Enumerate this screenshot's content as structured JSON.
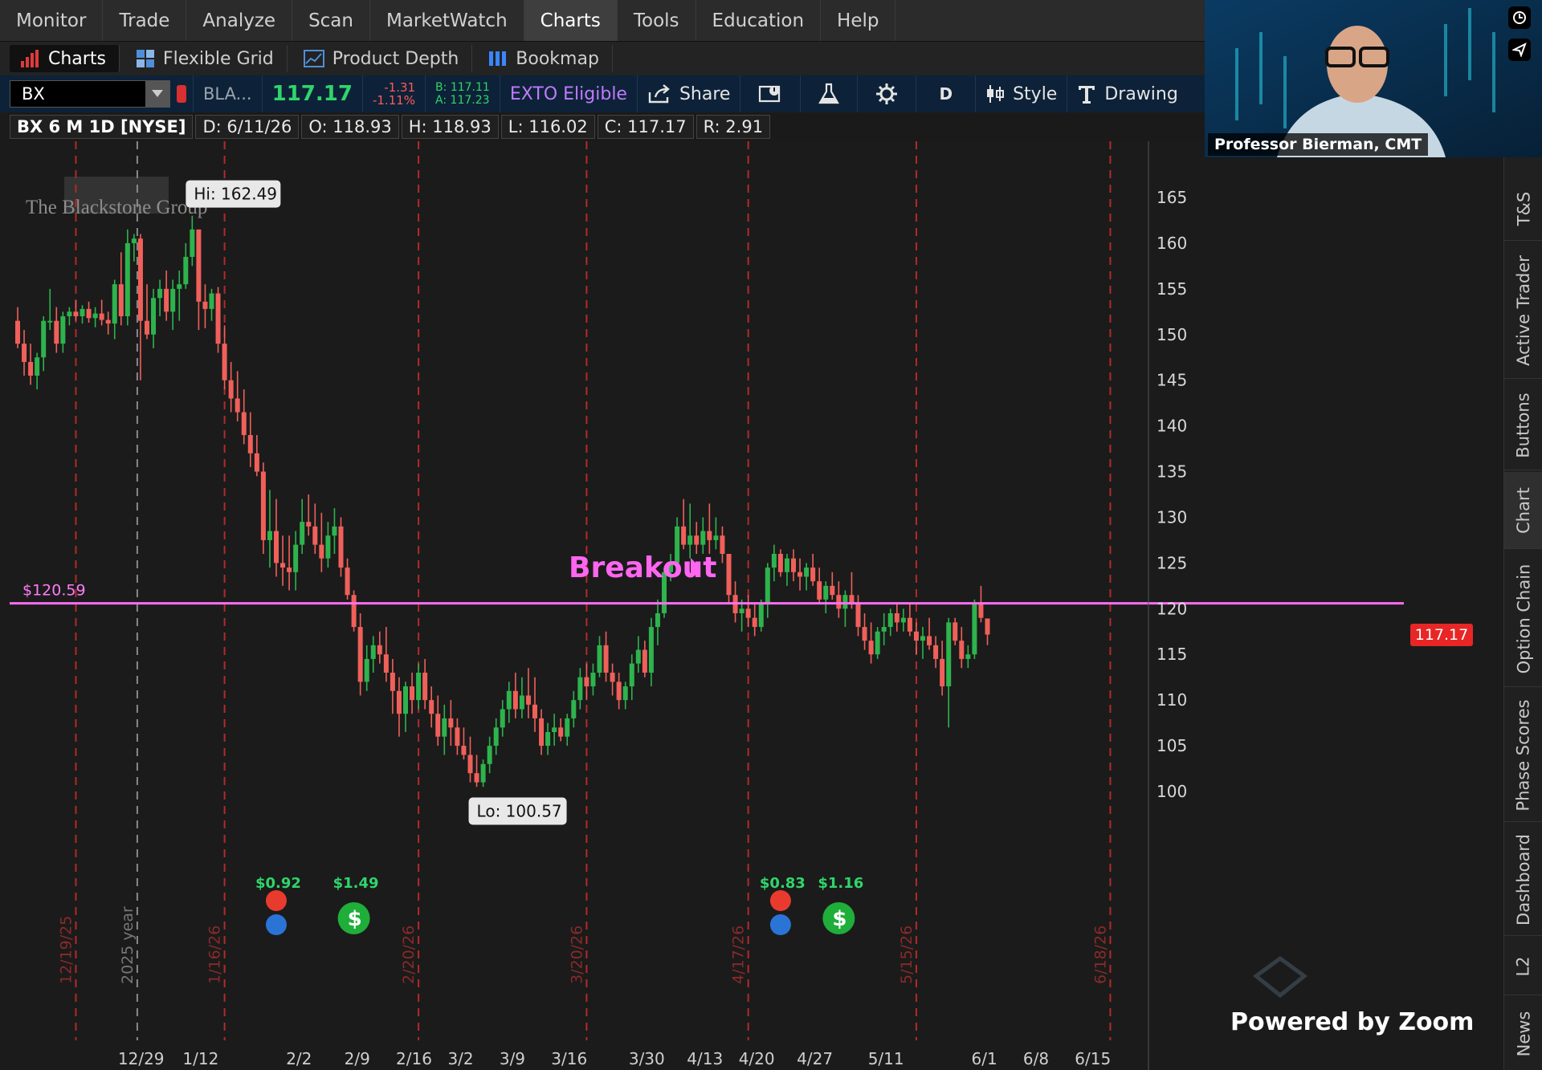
{
  "menu": [
    "Monitor",
    "Trade",
    "Analyze",
    "Scan",
    "MarketWatch",
    "Charts",
    "Tools",
    "Education",
    "Help"
  ],
  "subtabs": {
    "charts": "Charts",
    "flexible_grid": "Flexible Grid",
    "product_depth": "Product Depth",
    "bookmap": "Bookmap"
  },
  "toolbar": {
    "symbol": "BX",
    "company": "BLA...",
    "last": "117.17",
    "change": "-1.31",
    "change_pct": "-1.11%",
    "bid": "B: 117.11",
    "ask": "A: 117.23",
    "exto": "EXTO Eligible",
    "share": "Share",
    "aggregation": "D",
    "style": "Style",
    "drawings": "Drawing"
  },
  "infobar": {
    "title": "BX 6 M 1D [NYSE]",
    "date": "D: 6/11/26",
    "open": "O: 118.93",
    "high": "H: 118.93",
    "low": "L: 116.02",
    "close": "C: 117.17",
    "range": "R: 2.91"
  },
  "chart_data": {
    "type": "candlestick",
    "symbol": "BX",
    "watermark": "The Blackstone Group",
    "ylim": [
      98,
      169
    ],
    "yticks": [
      100,
      105,
      110,
      115,
      120,
      125,
      130,
      135,
      140,
      145,
      150,
      155,
      160,
      165
    ],
    "xticks": [
      "12/29",
      "1/12",
      "2/2",
      "2/9",
      "2/16",
      "3/2",
      "3/9",
      "3/16",
      "3/30",
      "4/13",
      "4/20",
      "4/27",
      "5/11",
      "6/1",
      "6/8",
      "6/15"
    ],
    "session_markers": [
      "12/19/25",
      "1/16/26",
      "2/20/26",
      "3/20/26",
      "4/17/26",
      "5/15/26",
      "6/18/26"
    ],
    "year_marker": "2025 year",
    "high_label": "Hi: 162.49",
    "low_label": "Lo: 100.57",
    "horizontal_line": {
      "value": 120.59,
      "label": "$120.59",
      "color": "#ff6ef5"
    },
    "annotation": "Breakout",
    "last_price_tag": "117.17",
    "dividends": [
      "$0.92",
      "$1.49",
      "$0.83",
      "$1.16"
    ],
    "colors": {
      "up": "#2eb34d",
      "down": "#f0605a",
      "background": "#1b1b1b",
      "expiration": "#b32a2a"
    },
    "candles": [
      [
        151.5,
        153,
        148.5,
        149
      ],
      [
        149,
        150.5,
        145.5,
        147
      ],
      [
        147,
        149,
        144.5,
        145.5
      ],
      [
        145.5,
        148,
        144,
        147.5
      ],
      [
        147.5,
        152,
        146,
        151.5
      ],
      [
        151.5,
        155,
        150.5,
        151.5
      ],
      [
        151.5,
        153,
        148,
        149
      ],
      [
        149,
        152.5,
        148,
        152
      ],
      [
        152,
        153,
        151,
        152.5
      ],
      [
        152.5,
        153.8,
        151.5,
        152
      ],
      [
        152,
        153.2,
        151.2,
        152.8
      ],
      [
        152.8,
        153.6,
        151.3,
        151.8
      ],
      [
        151.8,
        153,
        150.8,
        152.3
      ],
      [
        152.3,
        153.8,
        151,
        151.6
      ],
      [
        151.6,
        152.5,
        150,
        151.2
      ],
      [
        151.2,
        156,
        149.5,
        155.5
      ],
      [
        155.5,
        159,
        151,
        152
      ],
      [
        152,
        161.5,
        151,
        160
      ],
      [
        160,
        161,
        158,
        160.5
      ],
      [
        160.5,
        161,
        145,
        151.5
      ],
      [
        151.5,
        155.5,
        149.5,
        150
      ],
      [
        150,
        155,
        148.5,
        154
      ],
      [
        154,
        156,
        152,
        155
      ],
      [
        155,
        157,
        151.5,
        152.5
      ],
      [
        152.5,
        156,
        150.5,
        155
      ],
      [
        155,
        157,
        151.5,
        155.5
      ],
      [
        155.5,
        160,
        155,
        158.5
      ],
      [
        158.5,
        163,
        157.5,
        161.5
      ],
      [
        161.5,
        160.6,
        150.5,
        153.6
      ],
      [
        153.6,
        155.5,
        150.7,
        152.8
      ],
      [
        152.8,
        155,
        151.5,
        154.5
      ],
      [
        154.5,
        155.2,
        148,
        149
      ],
      [
        149,
        151,
        144,
        145
      ],
      [
        145,
        147,
        141.5,
        143
      ],
      [
        143,
        146,
        140.5,
        141.5
      ],
      [
        141.5,
        144,
        138,
        139
      ],
      [
        139,
        141.5,
        135.5,
        137
      ],
      [
        137,
        139,
        134.5,
        135
      ],
      [
        135,
        136,
        126,
        127.5
      ],
      [
        127.5,
        133,
        124.5,
        128.5
      ],
      [
        128.5,
        132,
        123.5,
        125
      ],
      [
        125,
        128,
        122.5,
        124.5
      ],
      [
        124.5,
        128,
        122,
        124
      ],
      [
        124,
        128.5,
        122,
        127
      ],
      [
        127,
        132,
        126,
        129.5
      ],
      [
        129.5,
        132.5,
        128,
        129
      ],
      [
        129,
        131.5,
        126,
        127
      ],
      [
        127,
        130.5,
        124,
        125.5
      ],
      [
        125.5,
        129.5,
        124.5,
        128
      ],
      [
        128,
        131,
        126,
        129
      ],
      [
        129,
        130,
        123.5,
        124.5
      ],
      [
        124.5,
        125.5,
        121,
        121.5
      ],
      [
        121.5,
        122,
        117.5,
        118
      ],
      [
        118,
        119.5,
        110.5,
        112
      ],
      [
        112,
        116,
        111,
        114.5
      ],
      [
        114.5,
        117,
        113,
        116
      ],
      [
        116,
        117.5,
        114,
        115
      ],
      [
        115,
        118,
        112,
        113
      ],
      [
        113,
        114.5,
        108.5,
        111
      ],
      [
        111,
        112.5,
        106,
        108.5
      ],
      [
        108.5,
        112,
        106.5,
        111.5
      ],
      [
        111.5,
        113,
        108.5,
        110
      ],
      [
        110,
        114,
        109,
        113
      ],
      [
        113,
        114.5,
        109,
        110
      ],
      [
        110,
        111.5,
        107,
        108.5
      ],
      [
        108.5,
        110.5,
        105,
        106
      ],
      [
        106,
        109.5,
        104,
        108
      ],
      [
        108,
        110,
        105,
        107
      ],
      [
        107,
        108,
        104,
        105
      ],
      [
        105,
        107,
        103.5,
        104
      ],
      [
        104,
        106,
        101,
        102
      ],
      [
        102,
        104,
        100.5,
        101
      ],
      [
        101,
        103.5,
        100.5,
        103
      ],
      [
        103,
        106,
        102,
        105
      ],
      [
        105,
        108,
        104,
        107
      ],
      [
        107,
        110,
        106,
        109
      ],
      [
        109,
        112,
        107.5,
        111
      ],
      [
        111,
        113,
        108,
        109
      ],
      [
        109,
        112.5,
        108,
        110.5
      ],
      [
        110.5,
        113.5,
        108,
        109.5
      ],
      [
        109.5,
        112.5,
        106.5,
        108
      ],
      [
        108,
        109,
        104,
        105
      ],
      [
        105,
        107.5,
        104,
        106.5
      ],
      [
        106.5,
        108.5,
        105,
        107
      ],
      [
        107,
        108,
        105.5,
        106
      ],
      [
        106,
        108.5,
        105,
        108
      ],
      [
        108,
        111,
        107,
        110
      ],
      [
        110,
        113.5,
        109,
        112.5
      ],
      [
        112.5,
        114,
        110,
        111.5
      ],
      [
        111.5,
        114,
        110.5,
        113
      ],
      [
        113,
        117,
        112.5,
        116
      ],
      [
        116,
        117.5,
        112,
        113
      ],
      [
        113,
        114,
        110.5,
        112
      ],
      [
        112,
        113,
        109,
        110
      ],
      [
        110,
        112,
        109,
        111.5
      ],
      [
        111.5,
        115,
        110,
        114
      ],
      [
        114,
        117,
        113,
        115.5
      ],
      [
        115.5,
        116.5,
        112.5,
        113
      ],
      [
        113,
        119,
        111.5,
        118
      ],
      [
        118,
        121,
        116,
        119.5
      ],
      [
        119.5,
        124.5,
        119,
        124
      ],
      [
        124,
        126,
        123,
        125
      ],
      [
        125,
        130,
        124,
        129
      ],
      [
        129,
        132,
        126.5,
        127
      ],
      [
        127,
        131.5,
        125.5,
        128
      ],
      [
        128,
        129.5,
        126,
        127
      ],
      [
        127,
        130,
        126,
        128.5
      ],
      [
        128.5,
        131.5,
        126,
        127.5
      ],
      [
        127.5,
        130,
        126.5,
        128
      ],
      [
        128,
        129,
        125,
        126
      ],
      [
        126,
        125.5,
        120.5,
        121.5
      ],
      [
        121.5,
        123,
        118.5,
        119.5
      ],
      [
        119.5,
        121,
        117.5,
        120
      ],
      [
        120,
        121.5,
        118,
        119
      ],
      [
        119,
        120.5,
        117,
        118
      ],
      [
        118,
        121,
        117.5,
        120.5
      ],
      [
        120.5,
        125,
        119,
        124.5
      ],
      [
        124.5,
        127,
        123,
        126
      ],
      [
        126,
        126.5,
        123.5,
        124
      ],
      [
        124,
        126,
        122.5,
        125.5
      ],
      [
        125.5,
        126.5,
        123,
        124
      ],
      [
        124,
        125.5,
        122,
        123.5
      ],
      [
        123.5,
        125,
        122,
        124.5
      ],
      [
        124.5,
        126,
        122.5,
        123
      ],
      [
        123,
        124.5,
        120.5,
        121
      ],
      [
        121,
        123,
        119.5,
        122.5
      ],
      [
        122.5,
        124,
        121,
        121.5
      ],
      [
        121.5,
        123,
        119,
        120
      ],
      [
        120,
        122,
        118,
        121.5
      ],
      [
        121.5,
        124,
        120,
        120.5
      ],
      [
        120.5,
        121.5,
        117,
        118
      ],
      [
        118,
        119.5,
        115.5,
        116.5
      ],
      [
        116.5,
        118.5,
        114,
        115
      ],
      [
        115,
        118,
        114.5,
        117.5
      ],
      [
        117.5,
        119.5,
        116,
        118
      ],
      [
        118,
        120,
        117,
        119.5
      ],
      [
        119.5,
        120.5,
        117.5,
        118.5
      ],
      [
        118.5,
        120,
        117.5,
        119
      ],
      [
        119,
        120.5,
        117,
        117.5
      ],
      [
        117.5,
        118.5,
        115,
        116.5
      ],
      [
        116.5,
        118,
        114.5,
        117
      ],
      [
        117,
        119,
        115.5,
        116
      ],
      [
        116,
        117,
        113.5,
        114.5
      ],
      [
        114.5,
        116.5,
        110.5,
        111.5
      ],
      [
        111.5,
        119,
        107,
        118.5
      ],
      [
        118.5,
        119,
        116,
        116.5
      ],
      [
        116.5,
        118,
        113.5,
        114.5
      ],
      [
        114.5,
        116,
        113.5,
        115
      ],
      [
        115,
        121,
        114.5,
        120.5
      ],
      [
        120.5,
        122.5,
        118.5,
        119
      ],
      [
        118.93,
        118.93,
        116.02,
        117.17
      ]
    ]
  }
}
